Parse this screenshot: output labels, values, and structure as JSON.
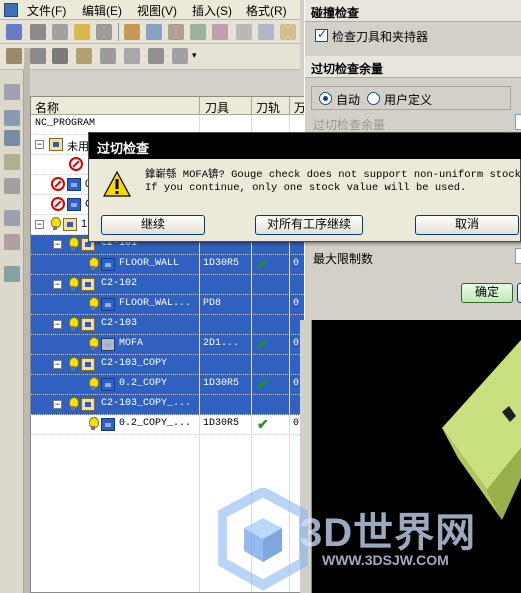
{
  "menu": {
    "items": [
      "文件(F)",
      "编辑(E)",
      "视图(V)",
      "插入(S)",
      "格式(R)"
    ]
  },
  "navigator": {
    "columns": {
      "name": "名称",
      "tool": "刀具",
      "path": "刀轨",
      "extra": "万"
    },
    "rows": [
      {
        "name": "NC_PROGRAM",
        "tool": "",
        "path": "",
        "extra": "",
        "sel": false
      },
      {
        "name": "未用",
        "tool": "",
        "path": "",
        "extra": "",
        "sel": false
      },
      {
        "name": "",
        "tool": "",
        "path": "",
        "extra": "",
        "sel": false
      },
      {
        "name": "0",
        "tool": "",
        "path": "",
        "extra": "",
        "sel": false
      },
      {
        "name": "C",
        "tool": "",
        "path": "",
        "extra": "",
        "sel": false
      },
      {
        "name": "1",
        "tool": "",
        "path": "",
        "extra": "",
        "sel": false
      },
      {
        "name": "C2-101",
        "tool": "",
        "path": "",
        "extra": "",
        "sel": true
      },
      {
        "name": "FLOOR_WALL",
        "tool": "1D30R5",
        "path": "✔",
        "extra": "0",
        "sel": true
      },
      {
        "name": "C2-102",
        "tool": "",
        "path": "",
        "extra": "",
        "sel": true
      },
      {
        "name": "FLOOR_WAL...",
        "tool": "PD8",
        "path": "",
        "extra": "0",
        "sel": true
      },
      {
        "name": "C2-103",
        "tool": "",
        "path": "",
        "extra": "",
        "sel": true
      },
      {
        "name": "MOFA",
        "tool": "2D1...",
        "path": "✔",
        "extra": "0",
        "sel": true
      },
      {
        "name": "C2-103_COPY",
        "tool": "",
        "path": "",
        "extra": "",
        "sel": true
      },
      {
        "name": "0.2_COPY",
        "tool": "1D30R5",
        "path": "✔",
        "extra": "0",
        "sel": true
      },
      {
        "name": "C2-103_COPY_...",
        "tool": "",
        "path": "",
        "extra": "",
        "sel": true
      },
      {
        "name": "0.2_COPY_...",
        "tool": "1D30R5",
        "path": "✔",
        "extra": "0",
        "sel": false
      }
    ]
  },
  "panel": {
    "collision_header": "碰撞检查",
    "check_tool_holder": "检查刀具和夹持器",
    "gouge_header": "过切检查余量",
    "auto_label": "自动",
    "user_label": "用户定义",
    "gouge_stock_label": "过切检查余量",
    "max_limit_label": "最大限制数",
    "ok_button": "确定"
  },
  "modal": {
    "title": "过切检查",
    "message": "鎿嶄綔 MOFA锛? Gouge check does not support non-uniform stock.\nIf you continue, only one stock value will be used.",
    "continue_button": "继续",
    "continue_all_button": "对所有工序继续",
    "cancel_button": "取消"
  },
  "watermark": {
    "brand": "3D世界网",
    "url": "WWW.3DSJW.COM"
  },
  "colors": {
    "selection": "#3060c0",
    "modal_title": "#000000",
    "view_bg": "#000000",
    "block_face": "#c8e080"
  }
}
